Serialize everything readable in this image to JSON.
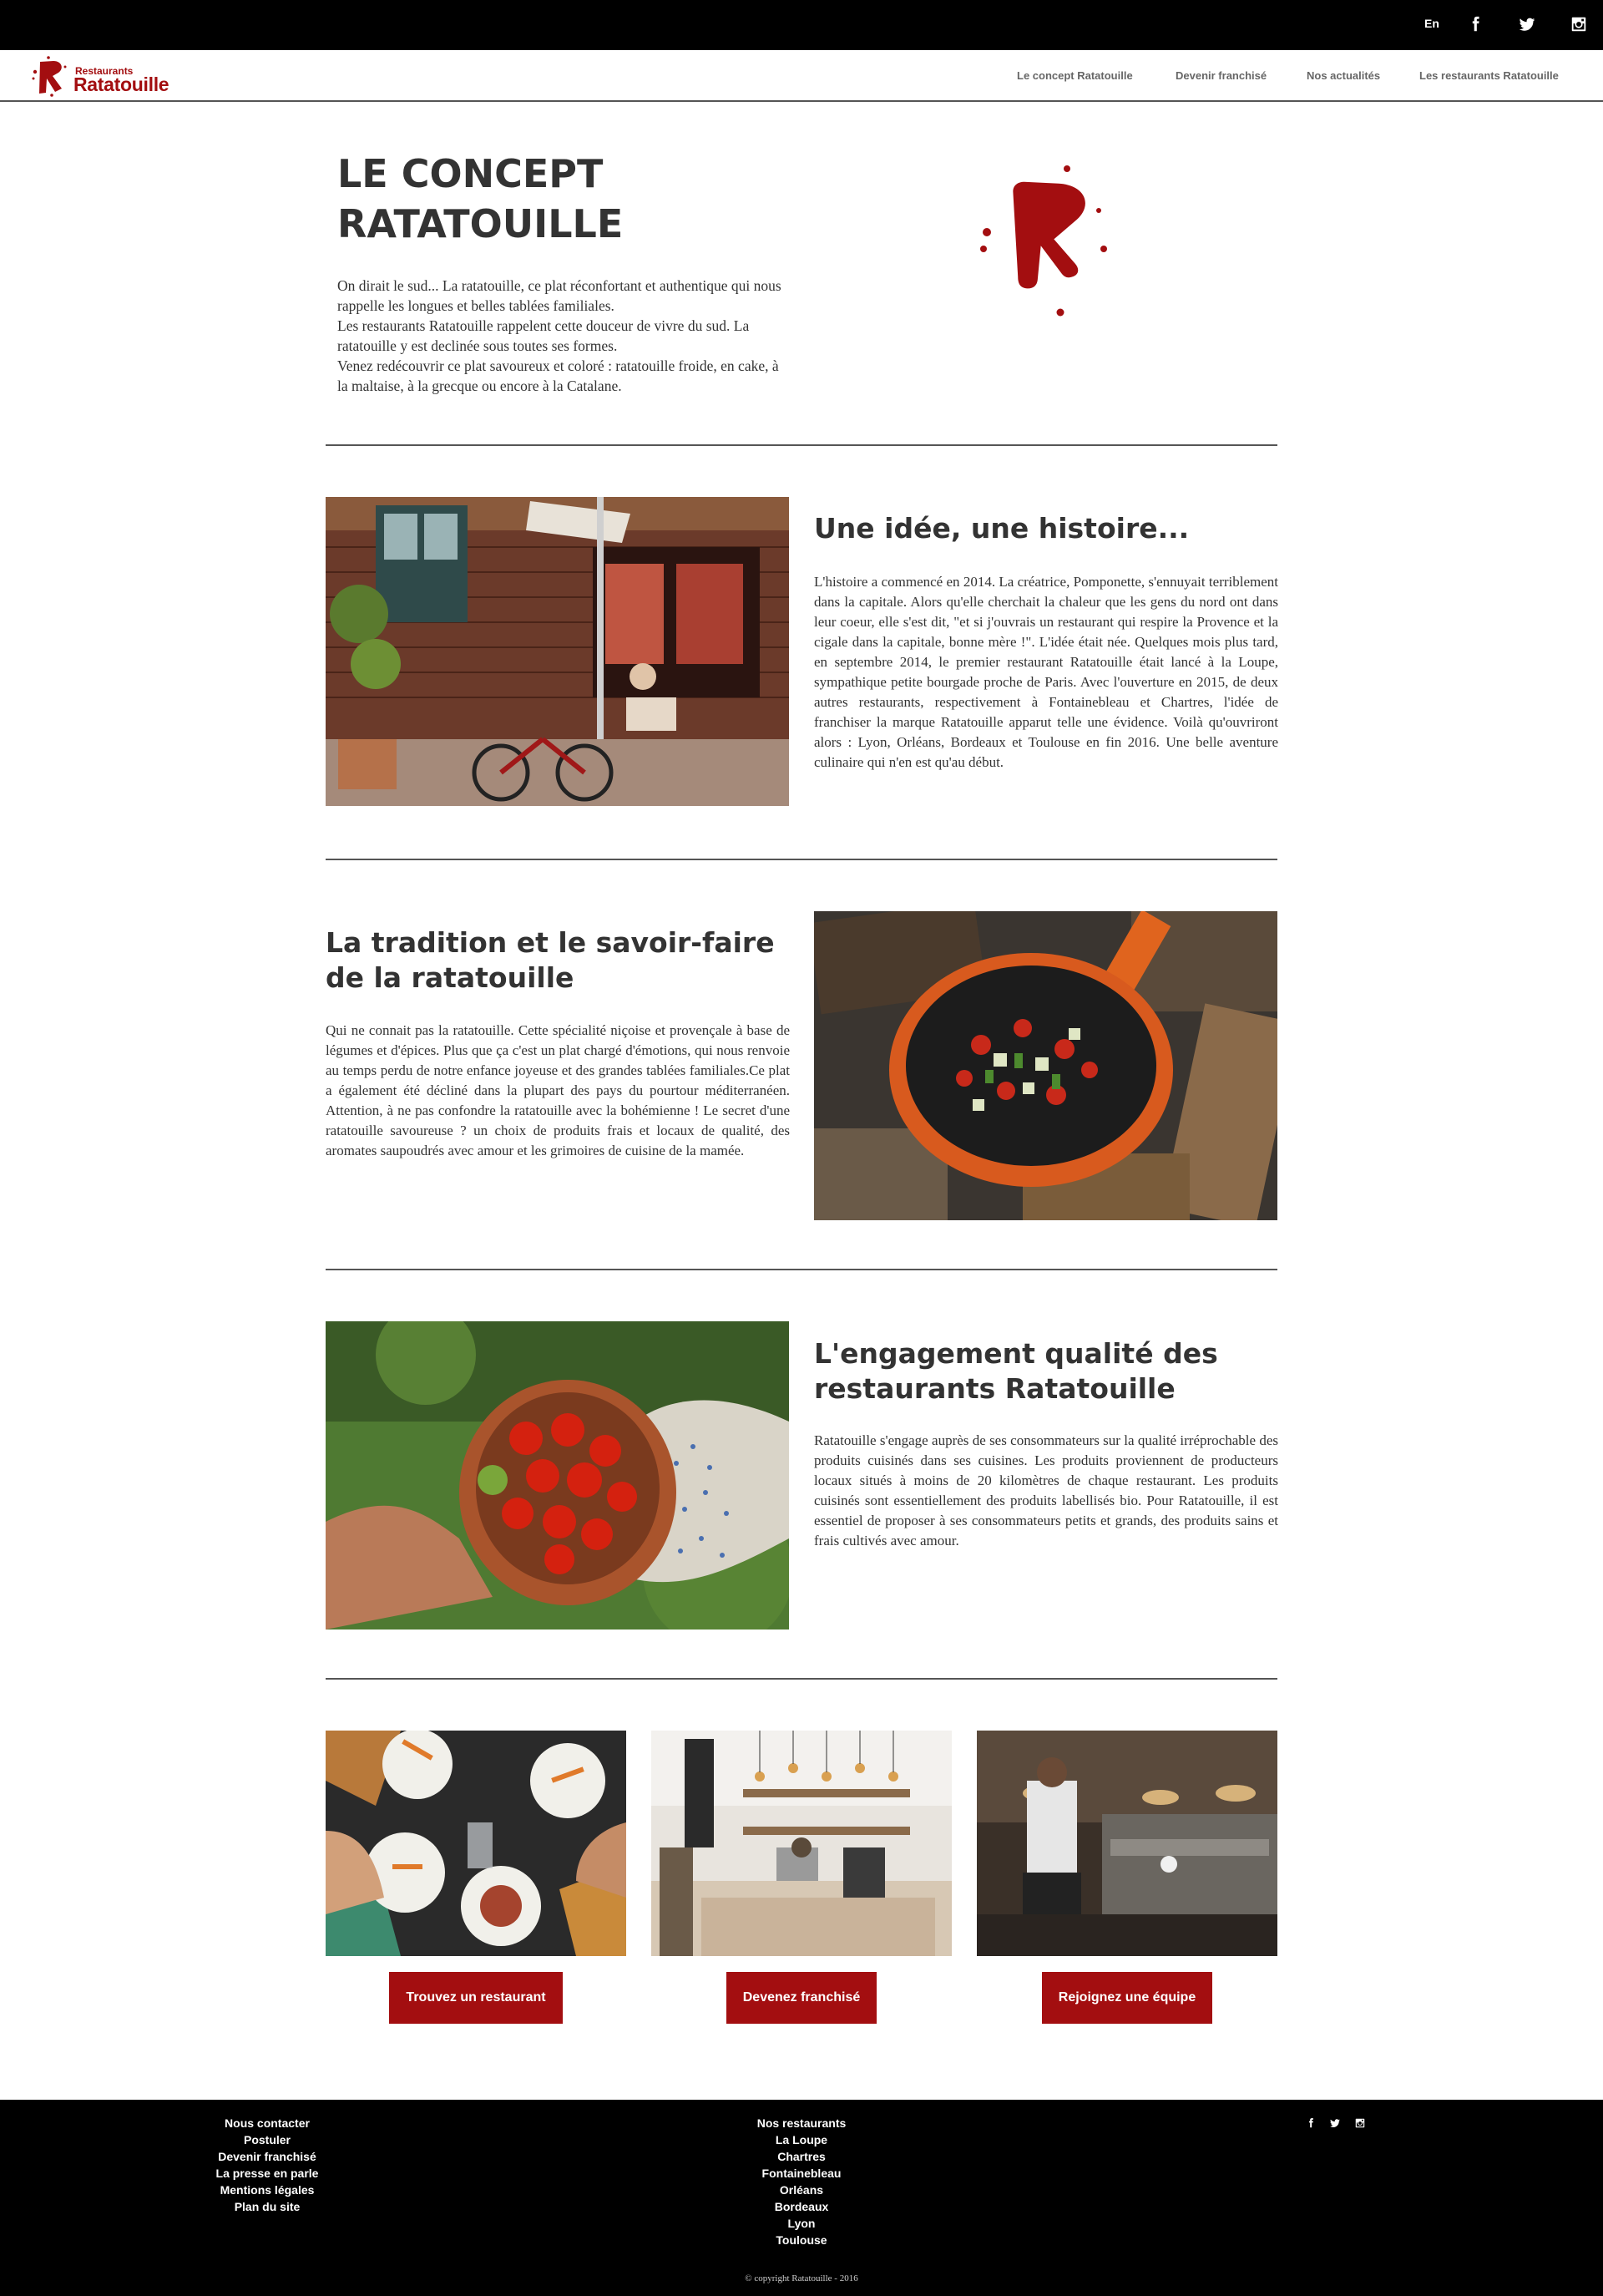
{
  "topbar": {
    "lang": "En",
    "icons": [
      "facebook-icon",
      "twitter-icon",
      "instagram-icon"
    ]
  },
  "brand": {
    "small": "Restaurants",
    "big": "Ratatouille",
    "color": "#a30e10"
  },
  "nav": {
    "items": [
      {
        "label": "Le concept Ratatouille"
      },
      {
        "label": "Devenir franchisé"
      },
      {
        "label": "Nos actualités"
      },
      {
        "label": "Les restaurants Ratatouille"
      }
    ]
  },
  "hero": {
    "title_line1": "LE CONCEPT",
    "title_line2": "RATATOUILLE",
    "paragraphs": [
      "On dirait le sud... La ratatouille, ce plat réconfortant et authentique qui nous rappelle les longues et belles tablées familiales.",
      "Les restaurants Ratatouille rappelent cette douceur de vivre du sud. La ratatouille y est declinée sous toutes ses formes.",
      "Venez redécouvrir ce plat savoureux et coloré : ratatouille froide, en cake, à la maltaise, à la grecque ou encore à la Catalane."
    ]
  },
  "sections": [
    {
      "title": "Une idée, une histoire...",
      "text": "L'histoire a commencé en 2014. La créatrice, Pomponette, s'ennuyait terriblement dans la capitale. Alors qu'elle cherchait la chaleur que les gens du nord ont dans leur coeur, elle s'est dit, \"et si j'ouvrais un restaurant qui respire la Provence et la cigale dans la capitale, bonne mère !\". L'idée était née. Quelques mois plus tard, en septembre 2014, le premier restaurant Ratatouille était lancé à la Loupe, sympathique petite bourgade proche de Paris. Avec l'ouverture en 2015, de deux autres restaurants, respectivement à Fontainebleau et Chartres, l'idée de franchiser la marque Ratatouille apparut telle une évidence. Voilà qu'ouvriront alors : Lyon, Orléans, Bordeaux et Toulouse en fin 2016. Une belle aventure culinaire qui n'en est qu'au début."
    },
    {
      "title": "La tradition et le savoir-faire de la ratatouille",
      "text": "Qui ne connait pas la ratatouille. Cette spécialité niçoise et provençale à base de légumes et d'épices. Plus que ça c'est un plat chargé d'émotions, qui nous renvoie au temps perdu de notre enfance joyeuse et des grandes tablées familiales.Ce plat a également été décliné dans la plupart des pays du pourtour méditerranéen. Attention, à ne pas confondre la ratatouille avec la bohémienne ! Le secret d'une ratatouille savoureuse ? un choix de produits frais et locaux de qualité, des aromates saupoudrés avec amour et les grimoires de cuisine de la mamée."
    },
    {
      "title": "L'engagement qualité des restaurants Ratatouille",
      "text": "Ratatouille s'engage auprès de ses consommateurs sur la qualité irréprochable des produits cuisinés dans ses cuisines. Les produits proviennent de producteurs locaux situés à moins de 20 kilomètres de chaque restaurant. Les produits cuisinés sont essentiellement des produits labellisés bio. Pour Ratatouille, il est essentiel de proposer à ses consommateurs petits et grands, des produits sains et frais cultivés avec amour."
    }
  ],
  "cta": [
    {
      "label": "Trouvez un restaurant"
    },
    {
      "label": "Devenez franchisé"
    },
    {
      "label": "Rejoignez une équipe"
    }
  ],
  "footer": {
    "col1": [
      "Nous contacter",
      "Postuler",
      "Devenir franchisé",
      "La presse en parle",
      "Mentions légales",
      "Plan du site"
    ],
    "col2": [
      "Nos restaurants",
      "La Loupe",
      "Chartres",
      "Fontainebleau",
      "Orléans",
      "Bordeaux",
      "Lyon",
      "Toulouse"
    ],
    "social": [
      "facebook-icon",
      "twitter-icon",
      "instagram-icon"
    ],
    "copyright": "© copyright Ratatouille - 2016"
  }
}
